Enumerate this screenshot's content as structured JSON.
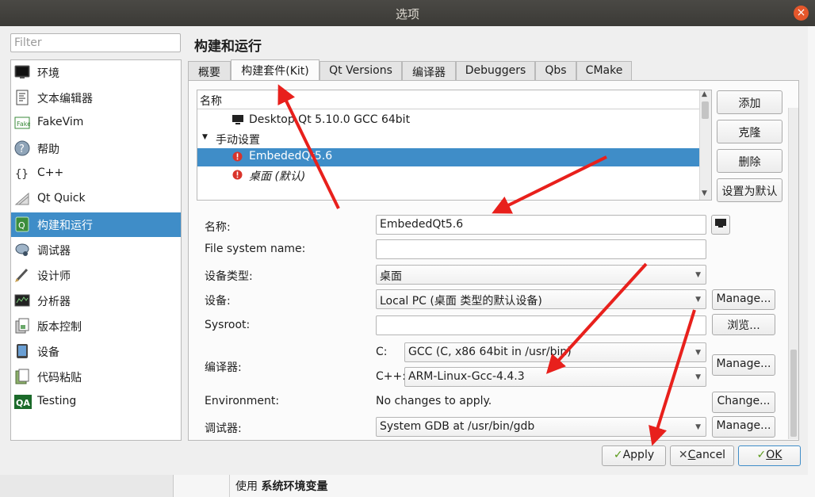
{
  "window": {
    "title": "选项"
  },
  "sidebar": {
    "filter_placeholder": "Filter",
    "items": [
      {
        "label": "环境",
        "icon": "monitor-icon"
      },
      {
        "label": "文本编辑器",
        "icon": "text-editor-icon"
      },
      {
        "label": "FakeVim",
        "icon": "fakevim-icon"
      },
      {
        "label": "帮助",
        "icon": "help-icon"
      },
      {
        "label": "C++",
        "icon": "cpp-braces-icon"
      },
      {
        "label": "Qt Quick",
        "icon": "qt-quick-icon"
      },
      {
        "label": "构建和运行",
        "icon": "build-run-icon",
        "selected": true
      },
      {
        "label": "调试器",
        "icon": "debugger-icon"
      },
      {
        "label": "设计师",
        "icon": "designer-icon"
      },
      {
        "label": "分析器",
        "icon": "analyzer-icon"
      },
      {
        "label": "版本控制",
        "icon": "version-control-icon"
      },
      {
        "label": "设备",
        "icon": "device-icon"
      },
      {
        "label": "代码粘贴",
        "icon": "code-paste-icon"
      },
      {
        "label": "Testing",
        "icon": "qa-testing-icon"
      }
    ]
  },
  "page": {
    "title": "构建和运行"
  },
  "tabs": [
    {
      "label": "概要"
    },
    {
      "label": "构建套件(Kit)",
      "active": true
    },
    {
      "label": "Qt Versions"
    },
    {
      "label": "编译器"
    },
    {
      "label": "Debuggers"
    },
    {
      "label": "Qbs"
    },
    {
      "label": "CMake"
    }
  ],
  "kit_tree": {
    "header": "名称",
    "rows": [
      {
        "label": "Desktop Qt 5.10.0 GCC 64bit",
        "icon": "monitor-icon"
      },
      {
        "label": "手动设置",
        "icon": "collapse-arrow-icon"
      },
      {
        "label": "EmbededQt5.6",
        "icon": "error-icon",
        "selected": true
      },
      {
        "label": "桌面 (默认)",
        "icon": "error-icon",
        "italic": true
      }
    ]
  },
  "kit_buttons": {
    "add": "添加",
    "clone": "克隆",
    "remove": "删除",
    "make_default": "设置为默认"
  },
  "form": {
    "name_label": "名称:",
    "name_value": "EmbededQt5.6",
    "fs_name_label": "File system name:",
    "fs_name_value": "",
    "device_type_label": "设备类型:",
    "device_type_value": "桌面",
    "device_label": "设备:",
    "device_value": "Local PC (桌面 类型的默认设备)",
    "device_manage": "Manage...",
    "sysroot_label": "Sysroot:",
    "sysroot_value": "",
    "sysroot_browse": "浏览...",
    "compiler_label": "编译器:",
    "compiler_c_label": "C:",
    "compiler_c_value": "GCC (C, x86 64bit in /usr/bin)",
    "compiler_cpp_label": "C++:",
    "compiler_cpp_value": "ARM-Linux-Gcc-4.4.3",
    "compiler_manage": "Manage...",
    "env_label": "Environment:",
    "env_value": "No changes to apply.",
    "env_change": "Change...",
    "debugger_label": "调试器:",
    "debugger_value": "System GDB at /usr/bin/gdb",
    "debugger_manage": "Manage..."
  },
  "dialog_buttons": {
    "apply": "Apply",
    "cancel_pre": "",
    "cancel_u": "C",
    "cancel_post": "ancel",
    "ok": "OK"
  },
  "status_bar": {
    "prefix": "使用 ",
    "bold": "系统环境变量"
  },
  "colors": {
    "selection": "#3f8dc8",
    "annotation_arrow": "#e8201c",
    "titlebar": "#3c3b37",
    "close_button": "#e5572b"
  }
}
